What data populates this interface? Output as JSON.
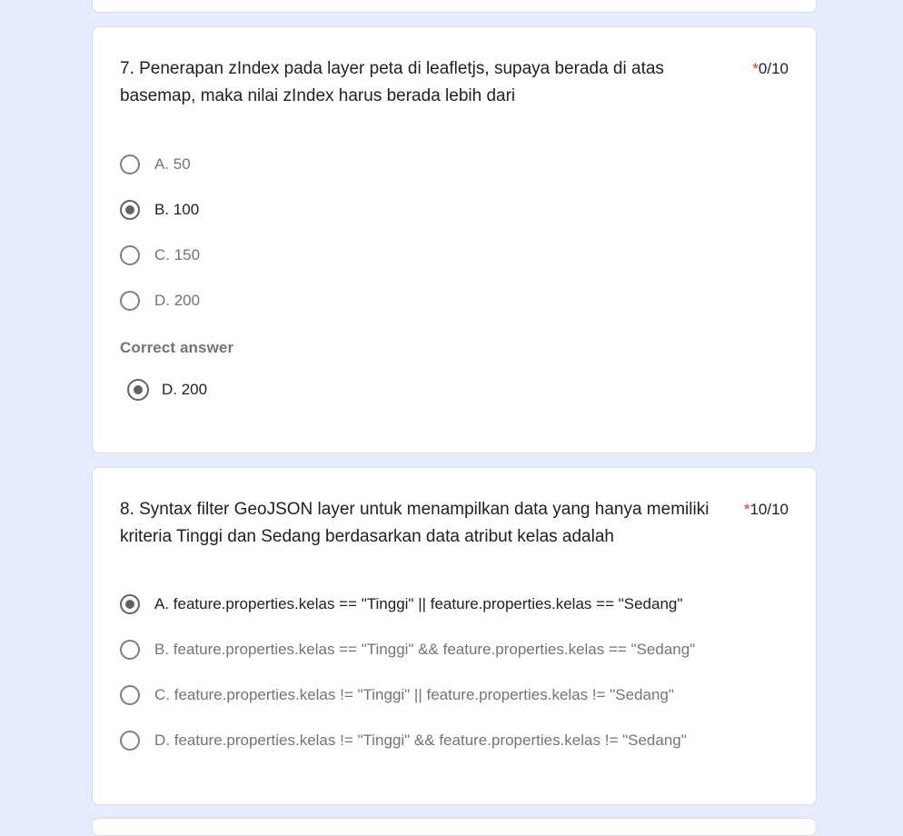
{
  "questions": [
    {
      "number": "7.",
      "text": "7. Penerapan zIndex pada layer peta di leafletjs, supaya berada di atas basemap, maka nilai zIndex harus berada lebih dari",
      "required_mark": "*",
      "score": "0/10",
      "options": [
        {
          "label": "A. 50",
          "selected": false
        },
        {
          "label": "B. 100",
          "selected": true
        },
        {
          "label": "C. 150",
          "selected": false
        },
        {
          "label": "D. 200",
          "selected": false
        }
      ],
      "correct_answer_title": "Correct answer",
      "correct_answer": "D. 200"
    },
    {
      "number": "8.",
      "text": "8. Syntax filter GeoJSON layer untuk menampilkan data yang hanya memiliki kriteria Tinggi dan Sedang berdasarkan data atribut kelas adalah",
      "required_mark": "*",
      "score": "10/10",
      "options": [
        {
          "label": "A. feature.properties.kelas == \"Tinggi\" || feature.properties.kelas == \"Sedang\"",
          "selected": true
        },
        {
          "label": "B. feature.properties.kelas == \"Tinggi\" && feature.properties.kelas == \"Sedang\"",
          "selected": false
        },
        {
          "label": "C. feature.properties.kelas != \"Tinggi\" || feature.properties.kelas != \"Sedang\"",
          "selected": false
        },
        {
          "label": "D. feature.properties.kelas != \"Tinggi\" && feature.properties.kelas != \"Sedang\"",
          "selected": false
        }
      ]
    }
  ],
  "colors": {
    "page_background": "#e6ecfb",
    "card_background": "#ffffff",
    "required_star": "#d93025",
    "radio_checked": "#5f6368",
    "text_primary": "#202124",
    "text_secondary": "#70757a"
  }
}
